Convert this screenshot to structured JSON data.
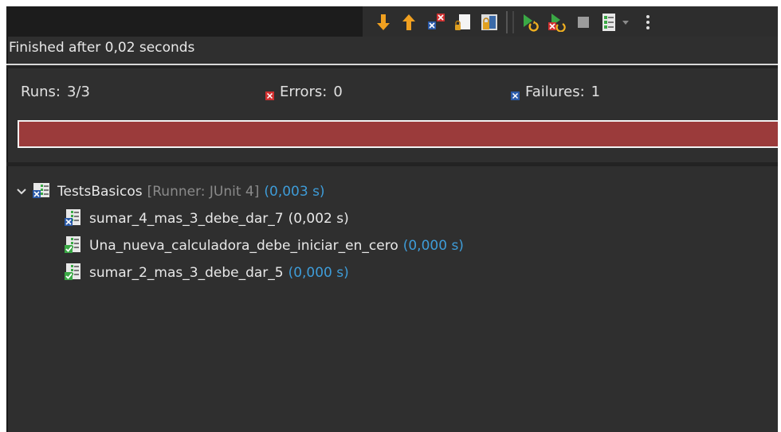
{
  "toolbar": {
    "buttons": [
      {
        "name": "next-failure-icon",
        "label": ""
      },
      {
        "name": "previous-failure-icon",
        "label": ""
      },
      {
        "name": "show-failures-only-icon",
        "label": ""
      },
      {
        "name": "scroll-lock-icon",
        "label": ""
      },
      {
        "name": "show-skipped-icon",
        "label": ""
      },
      {
        "name": "rerun-test-icon",
        "label": ""
      },
      {
        "name": "rerun-failed-first-icon",
        "label": ""
      },
      {
        "name": "stop-icon",
        "label": ""
      },
      {
        "name": "test-run-history-icon",
        "label": ""
      },
      {
        "name": "view-menu-icon",
        "label": ""
      }
    ],
    "colors": {
      "arrow": "#f0a020",
      "green": "#3aa845",
      "failure_blue": "#2a5aa8",
      "error_red": "#d03030"
    }
  },
  "status_message": "Finished after 0,02 seconds",
  "counters": {
    "runs_label": "Runs:",
    "runs_value": "3/3",
    "errors_label": "Errors:",
    "errors_value": "0",
    "failures_label": "Failures:",
    "failures_value": "1"
  },
  "progress": {
    "fraction": 1.0,
    "color": "#9b3b3b",
    "state": "failed"
  },
  "tree": {
    "suite": {
      "name": "TestsBasicos",
      "runner": "[Runner: JUnit 4]",
      "time": "(0,003 s)",
      "expanded": true,
      "status": "failure"
    },
    "tests": [
      {
        "name": "sumar_4_mas_3_debe_dar_7",
        "time": "(0,002 s)",
        "status": "failure"
      },
      {
        "name": "Una_nueva_calculadora_debe_iniciar_en_cero",
        "time": "(0,000 s)",
        "status": "passed"
      },
      {
        "name": "sumar_2_mas_3_debe_dar_5",
        "time": "(0,000 s)",
        "status": "passed"
      }
    ]
  }
}
